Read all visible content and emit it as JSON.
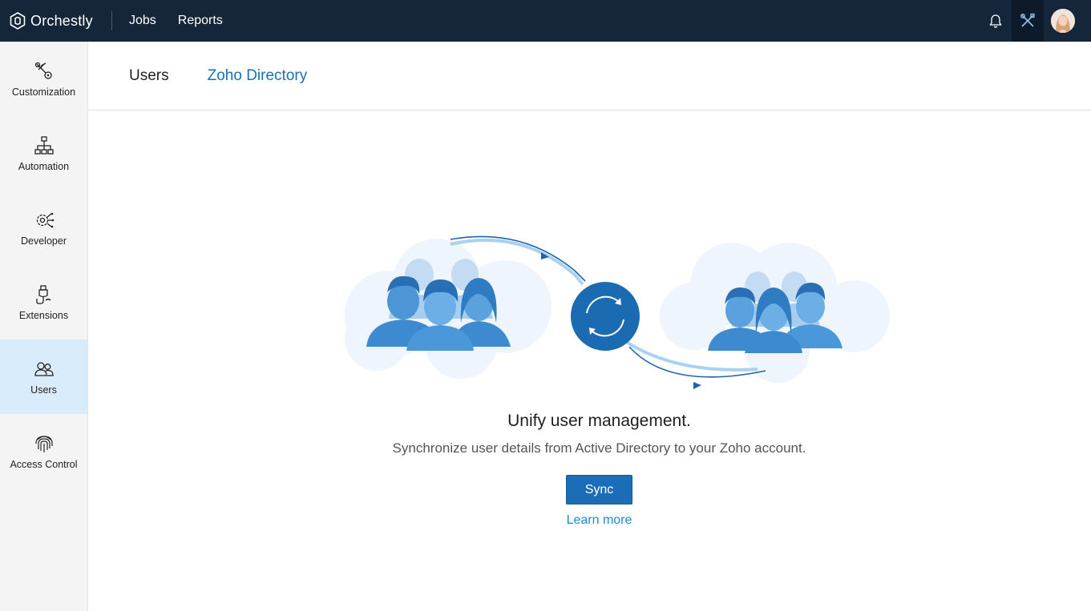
{
  "topbar": {
    "brand": "Orchestly",
    "nav": [
      "Jobs",
      "Reports"
    ],
    "icons": [
      "bell-icon",
      "tools-icon",
      "avatar"
    ]
  },
  "sidebar": {
    "items": [
      {
        "label": "Customization",
        "icon": "customization-icon"
      },
      {
        "label": "Automation",
        "icon": "automation-icon"
      },
      {
        "label": "Developer",
        "icon": "developer-icon"
      },
      {
        "label": "Extensions",
        "icon": "extensions-icon"
      },
      {
        "label": "Users",
        "icon": "users-icon",
        "active": true
      },
      {
        "label": "Access Control",
        "icon": "fingerprint-icon"
      }
    ]
  },
  "tabs": [
    {
      "label": "Users"
    },
    {
      "label": "Zoho Directory",
      "active": true
    }
  ],
  "main": {
    "title": "Unify user management.",
    "subtitle": "Synchronize user details from Active Directory to your Zoho account.",
    "sync_label": "Sync",
    "learn_more": "Learn more"
  },
  "colors": {
    "topbar": "#16263a",
    "accent": "#1c6db8",
    "link": "#1a8ad6",
    "sidebar_active": "#d9ecfc"
  }
}
